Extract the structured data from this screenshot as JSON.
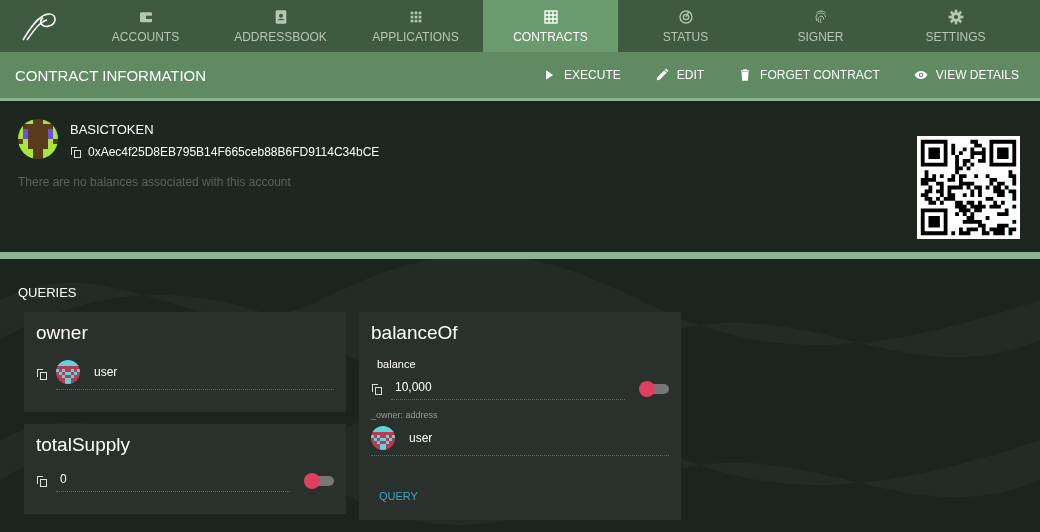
{
  "nav": {
    "tabs": [
      {
        "label": "ACCOUNTS",
        "kind": "wallet",
        "selected": false
      },
      {
        "label": "ADDRESSBOOK",
        "kind": "contact",
        "selected": false
      },
      {
        "label": "APPLICATIONS",
        "kind": "apps",
        "selected": false
      },
      {
        "label": "CONTRACTS",
        "kind": "grid",
        "selected": true
      },
      {
        "label": "STATUS",
        "kind": "gauge",
        "selected": false
      },
      {
        "label": "SIGNER",
        "kind": "fingerprint",
        "selected": false
      },
      {
        "label": "SETTINGS",
        "kind": "gear",
        "selected": false
      }
    ]
  },
  "toolbar": {
    "title": "CONTRACT INFORMATION",
    "actions": [
      {
        "label": "EXECUTE",
        "kind": "play"
      },
      {
        "label": "EDIT",
        "kind": "pencil"
      },
      {
        "label": "FORGET CONTRACT",
        "kind": "trash"
      },
      {
        "label": "VIEW DETAILS",
        "kind": "eye"
      }
    ]
  },
  "contract": {
    "name": "BASICTOKEN",
    "address": "0xAec4f25D8EB795B14F665ceb88B6FD9114C34bCE",
    "balances_note": "There are no balances associated with this account"
  },
  "queries": {
    "title": "QUERIES",
    "columns": [
      [
        {
          "name": "owner",
          "outputs": [
            {
              "kind": "address",
              "value": "user"
            }
          ]
        },
        {
          "name": "totalSupply",
          "outputs": [
            {
              "kind": "number",
              "value": "0",
              "on": false
            }
          ]
        }
      ],
      [
        {
          "name": "balanceOf",
          "outputs": [
            {
              "kind": "number",
              "label": "balance",
              "value": "10,000",
              "on": false
            }
          ],
          "inputs": [
            {
              "label": "_owner: address",
              "value": "user"
            }
          ],
          "button": "QUERY"
        }
      ]
    ]
  }
}
